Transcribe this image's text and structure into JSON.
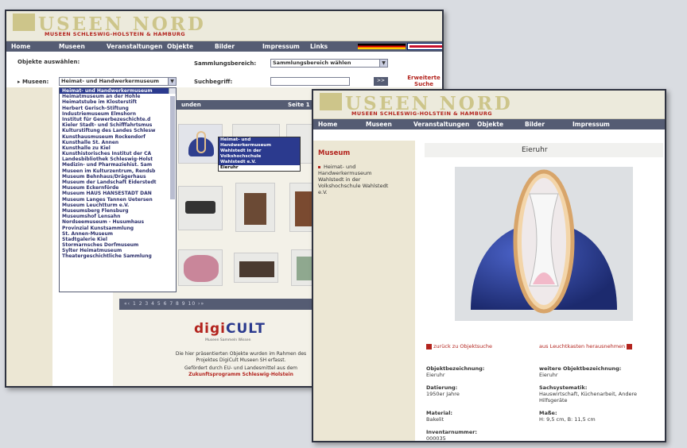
{
  "logo": {
    "text": "USEEN NORD",
    "subtitle": "MUSEEN SCHLESWIG-HOLSTEIN & HAMBURG"
  },
  "back_window": {
    "nav": [
      "Home",
      "Museen",
      "Veranstaltungen",
      "Objekte",
      "Bilder",
      "Impressum",
      "Links"
    ],
    "objects_label": "Objekte auswählen:",
    "museum_label": "▸ Museen:",
    "museum_select": "Heimat- und Handwerkermuseum",
    "sammlung_label": "Sammlungsbereich:",
    "sammlung_select": "Sammlungsbereich wählen",
    "suchbegriff_label": "Suchbegriff:",
    "go_button": ">>",
    "advanced_search": "Erweiterte Suche",
    "list_items": [
      "Heimat- und Handwerkermuseum",
      "Heimatmuseum an der Hohle",
      "Heimatstube im Klosterstift",
      "Herbert Gerisch-Stiftung",
      "Industriemuseum Elmshorn",
      "Institut für Gewerbezeschichte.d",
      "Kieler Stadt- und Schifffahrtsmus",
      "Kulturstiftung des Landes Schlesw",
      "Kunsthausmuseum Rockendorf",
      "Kunsthalle St. Annen",
      "Kunsthalle zu Kiel",
      "Kunsthistorisches Institut der CA",
      "Landesbibliothek Schleswig-Holst",
      "Medizin- und Pharmaziehist. Sam",
      "Museen im Kulturzentrum, Rendsb",
      "Museum Behnhaus/Drägerhaus",
      "Museum der Landschaft Eiderstedt",
      "Museum Eckernförde",
      "Museum HAUS HANSESTADT DAN",
      "Museum Langes Tannen Uetersen",
      "Museum Leuchtturm e.V.",
      "Museumsberg Flensburg",
      "Museumshof Lensahn",
      "Nordseemuseum - Husumhaus",
      "Provinzial Kunstsammlung",
      "St. Annen-Museum",
      "Stadtgalerie Kiel",
      "Stormarnsches Dorfmuseum",
      "Sylter Heimatmuseum",
      "Theatergeschichtliche Sammlung"
    ],
    "results_bar_left": "unden",
    "results_bar_right": "Seite 1 v",
    "popup_items": [
      "Heimat- und Handwerkermuseum",
      "Wahlstedt in der Volkshochschule",
      "Wahlstedt e.V.",
      "Eieruhr"
    ],
    "pager": "«‹ 1 2 3 4 5 6 7 8 9 10 ›»",
    "digicult_a": "digi",
    "digicult_b": "CULT",
    "digicult_sub": "Museen Sammeln Wissen",
    "footer1": "Die hier präsentierten Objekte wurden im Rahmen des",
    "footer2": "Projektes DigiCult Museen SH erfasst.",
    "footer3": "Gefördert durch EU- und Landesmittel aus dem",
    "footer4": "Zukunftsprogramm Schleswig-Holstein"
  },
  "front_window": {
    "nav": [
      "Home",
      "Museen",
      "Veranstaltungen",
      "Objekte",
      "Bilder",
      "Impressum"
    ],
    "museum_heading": "Museum",
    "museum_link": "Heimat- und Handwerkermuseum Wahlstedt in der Volkshochschule Wahlstedt e.V.",
    "object_title": "Eieruhr",
    "back_link": "zurück zu Objektsuche",
    "lightbox_link": "aus Leuchtkasten herausnehmen",
    "fields": [
      {
        "label": "Objektbezeichnung:",
        "value": "Eieruhr"
      },
      {
        "label": "weitere Objektbezeichnung:",
        "value": "Eieruhr"
      },
      {
        "label": "Datierung:",
        "value": "1950er Jahre"
      },
      {
        "label": "Sachsystematik:",
        "value": "Hauswirtschaft, Küchenarbeit, Andere Hilfsgeräte"
      },
      {
        "label": "Material:",
        "value": "Bakelit"
      },
      {
        "label": "Maße:",
        "value": "H: 9,5 cm, B: 11,5 cm"
      },
      {
        "label": "Inventarnummer:",
        "value": "000035"
      }
    ]
  }
}
